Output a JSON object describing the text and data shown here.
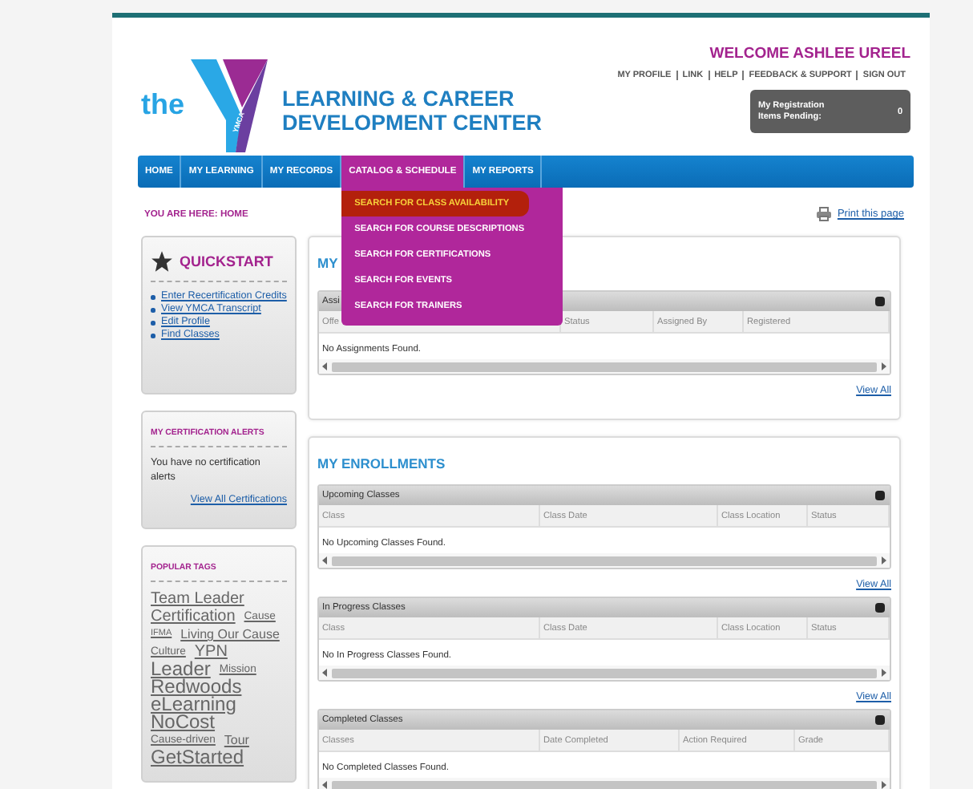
{
  "header": {
    "logo_word": "the",
    "logo_mark": "YMCA",
    "title_lines": [
      "LEARNING & CAREER",
      "DEVELOPMENT CENTER"
    ],
    "welcome": "WELCOME ASHLEE UREEL",
    "links": [
      "MY PROFILE",
      "LINK",
      "HELP",
      "FEEDBACK & SUPPORT",
      "SIGN OUT"
    ],
    "registration": {
      "label_lines": [
        "My Registration",
        "Items Pending:"
      ],
      "count": "0"
    }
  },
  "nav": {
    "items": [
      {
        "label": "HOME",
        "selected": false
      },
      {
        "label": "MY LEARNING",
        "selected": false
      },
      {
        "label": "MY RECORDS",
        "selected": false
      },
      {
        "label": "CATALOG & SCHEDULE",
        "selected": true
      },
      {
        "label": "MY REPORTS",
        "selected": false
      }
    ],
    "dropdown": [
      {
        "label": "SEARCH FOR CLASS AVAILABILITY",
        "selected": true
      },
      {
        "label": "SEARCH FOR COURSE DESCRIPTIONS",
        "selected": false
      },
      {
        "label": "SEARCH FOR CERTIFICATIONS",
        "selected": false
      },
      {
        "label": "SEARCH FOR EVENTS",
        "selected": false
      },
      {
        "label": "SEARCH FOR TRAINERS",
        "selected": false
      }
    ]
  },
  "breadcrumb": "YOU ARE HERE: HOME",
  "print_link": "Print this page",
  "sidebar": {
    "quickstart": {
      "title": "QUICKSTART",
      "links": [
        "Enter Recertification Credits",
        "View YMCA Transcript",
        "Edit Profile",
        "Find Classes"
      ]
    },
    "certification_alerts": {
      "title": "MY CERTIFICATION ALERTS",
      "message": "You have no certification alerts",
      "link": "View All Certifications"
    },
    "popular_tags": {
      "title": "POPULAR TAGS",
      "tags": [
        {
          "label": "Team Leader",
          "kind": "large"
        },
        {
          "label": "Certification",
          "kind": "large"
        },
        {
          "label": "Cause",
          "kind": "small"
        },
        {
          "label": "IFMA",
          "kind": "tiny"
        },
        {
          "label": "Living Our Cause",
          "kind": "medium"
        },
        {
          "label": "Culture",
          "kind": "small"
        },
        {
          "label": "YPN",
          "kind": "large"
        },
        {
          "label": "Leader",
          "kind": "huge"
        },
        {
          "label": "Mission",
          "kind": "small"
        },
        {
          "label": "Redwoods",
          "kind": "huge"
        },
        {
          "label": "eLearning",
          "kind": "huge"
        },
        {
          "label": "NoCost",
          "kind": "huge"
        },
        {
          "label": "Cause-driven",
          "kind": "small"
        },
        {
          "label": "Tour",
          "kind": "medium"
        },
        {
          "label": "GetStarted",
          "kind": "huge"
        }
      ]
    }
  },
  "main": [
    {
      "title": "MY",
      "grids": [
        {
          "title": "Assi",
          "columns": [
            "Offe",
            "Status",
            "Assigned By",
            "Registered"
          ],
          "empty": "No Assignments Found.",
          "view_all": "View All"
        }
      ]
    },
    {
      "title": "MY ENROLLMENTS",
      "grids": [
        {
          "title": "Upcoming Classes",
          "columns": [
            "Class",
            "Class Date",
            "Class Location",
            "Status"
          ],
          "empty": "No Upcoming Classes Found.",
          "view_all": "View All"
        },
        {
          "title": "In Progress Classes",
          "columns": [
            "Class",
            "Class Date",
            "Class Location",
            "Status"
          ],
          "empty": "No In Progress Classes Found.",
          "view_all": "View All"
        },
        {
          "title": "Completed Classes",
          "columns": [
            "Classes",
            "Date Completed",
            "Action Required",
            "Grade"
          ],
          "empty": "No Completed Classes Found."
        }
      ]
    }
  ]
}
